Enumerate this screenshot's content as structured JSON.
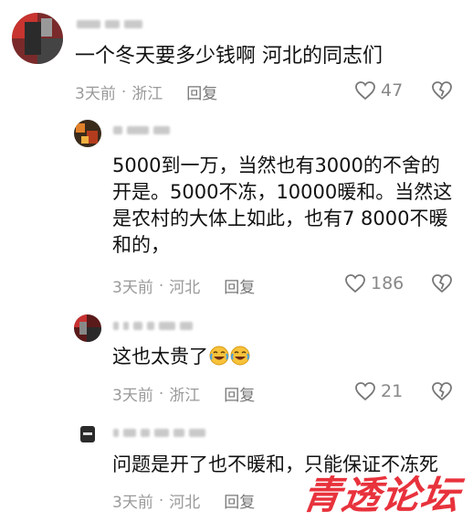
{
  "comments": [
    {
      "text": "一个冬天要多少钱啊 河北的同志们",
      "time": "3天前",
      "location": "浙江",
      "reply_label": "回复",
      "likes": "47"
    }
  ],
  "replies": [
    {
      "lines": [
        "5000到一万，当然也有3000的不舍的",
        "开是。5000不冻，10000暖和。当然这",
        "是农村的大体上如此，也有7 8000不暖",
        "和的，"
      ],
      "time": "3天前",
      "location": "河北",
      "reply_label": "回复",
      "likes": "186"
    },
    {
      "text": "这也太贵了",
      "emoji": [
        "crying-laughing-emoji",
        "crying-laughing-emoji"
      ],
      "time": "3天前",
      "location": "浙江",
      "reply_label": "回复",
      "likes": "21"
    },
    {
      "text": "问题是开了也不暖和，只能保证不冻死",
      "time": "3天前",
      "location": "河北",
      "reply_label": "回复"
    }
  ],
  "separator": "·",
  "watermark": "青透论坛",
  "icons": {
    "like": "heart-outline-icon",
    "dislike": "broken-heart-icon"
  },
  "colors": {
    "watermark": "#e8323c",
    "meta": "#9a9a9a"
  }
}
